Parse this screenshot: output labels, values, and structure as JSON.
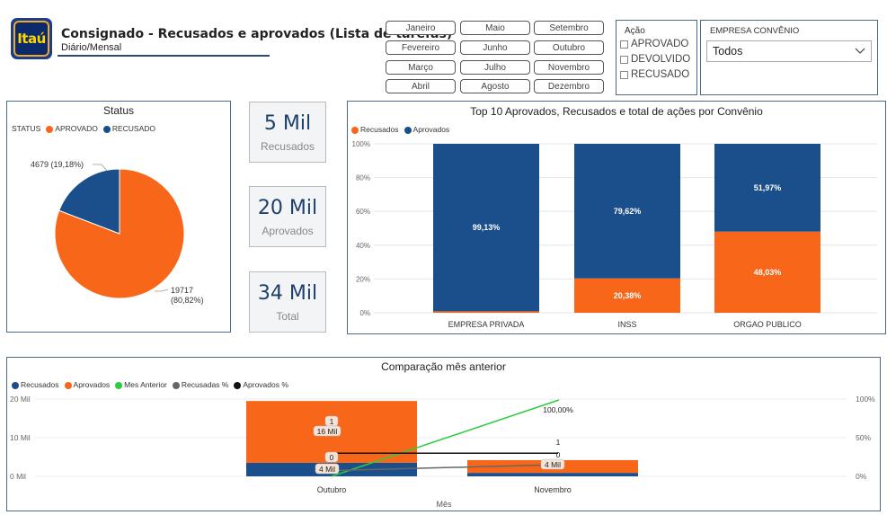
{
  "header": {
    "logo_text": "Itaú",
    "title": "Consignado - Recusados e aprovados (Lista de tarefas)",
    "subtitle": "Diário/Mensal"
  },
  "months": [
    "Janeiro",
    "Maio",
    "Setembro",
    "Fevereiro",
    "Junho",
    "Outubro",
    "Março",
    "Julho",
    "Novembro",
    "Abril",
    "Agosto",
    "Dezembro"
  ],
  "acao": {
    "title": "Ação",
    "items": [
      "APROVADO",
      "DEVOLVIDO",
      "RECUSADO"
    ]
  },
  "empresa": {
    "title": "EMPRESA CONVÊNIO",
    "selected": "Todos"
  },
  "kpis": [
    {
      "value": "5 Mil",
      "label": "Recusados"
    },
    {
      "value": "20 Mil",
      "label": "Aprovados"
    },
    {
      "value": "34 Mil",
      "label": "Total"
    }
  ],
  "colors": {
    "aprovado": "#f86619",
    "recusado": "#1a4f8b",
    "mes_anterior": "#2ecc40",
    "recusadas_pct": "#666666",
    "aprovados_pct": "#111111"
  },
  "chart_data": [
    {
      "type": "pie",
      "title": "Status",
      "legend_title": "STATUS",
      "labels": [
        "APROVADO",
        "RECUSADO"
      ],
      "values": [
        19717,
        4679
      ],
      "data_labels": [
        "19717 (80,82%)",
        "4679 (19,18%)"
      ]
    },
    {
      "type": "bar",
      "title": "Top 10 Aprovados, Recusados e total de ações por Convênio",
      "categories": [
        "EMPRESA PRIVADA",
        "INSS",
        "ORGAO PUBLICO"
      ],
      "series": [
        {
          "name": "Recusados",
          "values": [
            0.87,
            20.38,
            48.03
          ]
        },
        {
          "name": "Aprovados",
          "values": [
            99.13,
            79.62,
            51.97
          ]
        }
      ],
      "data_labels": {
        "Recusados": [
          "",
          "20,38%",
          "48,03%"
        ],
        "Aprovados": [
          "99,13%",
          "79,62%",
          "51,97%"
        ]
      },
      "y_ticks": [
        "0%",
        "20%",
        "40%",
        "60%",
        "80%",
        "100%"
      ],
      "ylim": [
        0,
        100
      ]
    },
    {
      "type": "bar",
      "title": "Comparação mês anterior",
      "xlabel": "Mês",
      "categories": [
        "Outubro",
        "Novembro"
      ],
      "series": [
        {
          "name": "Recusados",
          "values": [
            3500,
            900
          ]
        },
        {
          "name": "Aprovados",
          "values": [
            16000,
            3300
          ]
        },
        {
          "name": "Mes Anterior",
          "values": [
            0,
            1
          ]
        },
        {
          "name": "Recusadas %",
          "values": [
            0,
            4
          ]
        },
        {
          "name": "Aprovados %",
          "values": [
            1,
            1
          ]
        }
      ],
      "y_ticks": [
        "0 Mil",
        "10 Mil",
        "20 Mil"
      ],
      "y2_ticks": [
        "0%",
        "50%",
        "100%"
      ],
      "annotations": [
        "1",
        "16 Mil",
        "0",
        "4 Mil",
        "100,00%",
        "1",
        "0",
        "4 Mil"
      ]
    }
  ]
}
